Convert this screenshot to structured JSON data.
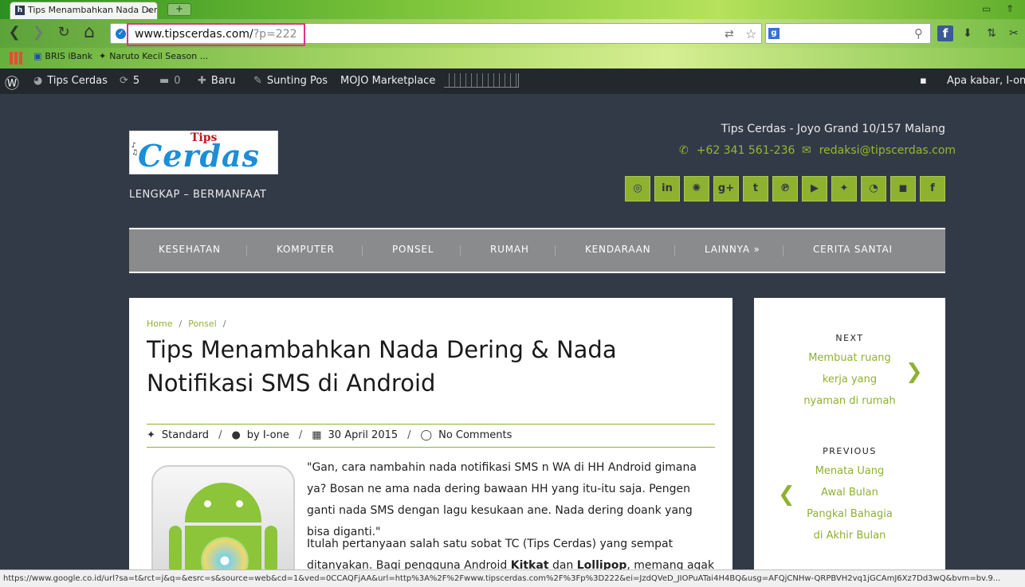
{
  "browser": {
    "tab_title": "Tips Menambahkan Nada Dering",
    "tab_favicon": "h",
    "tab_close": "×",
    "new_tab": "+",
    "url_main": "www.tipscerdas.com/",
    "url_query": "?p=222",
    "status_url": "https://www.google.co.id/url?sa=t&rct=j&q=&esrc=s&source=web&cd=1&ved=0CCAQFjAA&url=http%3A%2F%2Fwww.tipscerdas.com%2F%3Fp%3D222&ei=JzdQVeD_JIOPuATai4H4BQ&usg=AFQjCNHw-QRPBVH2vq1jGCAmJ6Xz7Dd3wQ&bvm=bv.9...",
    "bookmarks": [
      "BRIS iBank",
      "Naruto Kecil Season ..."
    ],
    "icons": {
      "back": "❮",
      "forward": "❯",
      "reload": "↻",
      "home": "⌂",
      "star": "☆",
      "translate": "⇄",
      "search": "⚲",
      "g": "g",
      "fb": "f",
      "ext2": "⬇",
      "ext3": "⇅",
      "ext4": "✂"
    }
  },
  "adminbar": {
    "site_name": "Tips Cerdas",
    "updates_count": "5",
    "comments_count": "0",
    "new_label": "Baru",
    "edit_label": "Sunting Pos",
    "marketplace_label": "MOJO Marketplace",
    "greeting": "Apa kabar, I-one",
    "icons": {
      "wp": "Ⓦ",
      "dashboard": "◕",
      "updates": "⟳",
      "comments": "▬",
      "plus": "✚",
      "pencil": "✎",
      "avatar": "▪"
    }
  },
  "header": {
    "logo_tips": "Tips",
    "logo_cerdas": "Cerdas",
    "tagline": "LENGKAP – BERMANFAAT",
    "address": "Tips Cerdas - Joyo Grand 10/157 Malang",
    "phone": "+62 341 561-236",
    "email": "redaksi@tipscerdas.com",
    "icons": {
      "phone": "✆",
      "email": "✉"
    },
    "social": [
      "◎",
      "in",
      "✺",
      "g+",
      "t",
      "℗",
      "▶",
      "✦",
      "◔",
      "◼",
      "f"
    ]
  },
  "nav": {
    "items": [
      "KESEHATAN",
      "KOMPUTER",
      "PONSEL",
      "RUMAH",
      "KENDARAAN",
      "LAINNYA »",
      "CERITA SANTAI"
    ]
  },
  "article": {
    "breadcrumb": [
      "Home",
      "Ponsel"
    ],
    "breadcrumb_sep": "/",
    "title": "Tips Menambahkan Nada Dering & Nada Notifikasi SMS di Android",
    "meta": {
      "format": "Standard",
      "author": "by I-one",
      "date": "30 April 2015",
      "comments": "No Comments",
      "sep": "/",
      "icons": {
        "pin": "✦",
        "user": "●",
        "calendar": "▦",
        "comment": "◯"
      }
    },
    "paragraph1": "\"Gan, cara nambahin nada notifikasi SMS n WA di HH Android gimana ya? Bosan ne ama nada dering bawaan HH yang itu-itu saja. Pengen ganti nada SMS dengan lagu kesukaan ane. Nada dering doank yang bisa diganti.\"",
    "paragraph2_a": "Itulah pertanyaan salah satu sobat TC (Tips Cerdas) yang sempat ditanyakan. Bagi pengguna Android ",
    "paragraph2_kitkat": "Kitkat",
    "paragraph2_b": " dan ",
    "paragraph2_lollipop": "Lollipop",
    "paragraph2_c": ", memang agak susah untuk"
  },
  "sidebar": {
    "next_label": "NEXT",
    "next_title": "Membuat ruang kerja yang nyaman di rumah",
    "previous_label": "PREVIOUS",
    "previous_title": "Menata Uang Awal Bulan Pangkal Bahagia di Akhir Bulan",
    "icons": {
      "next": "❯",
      "previous": "❮"
    }
  }
}
